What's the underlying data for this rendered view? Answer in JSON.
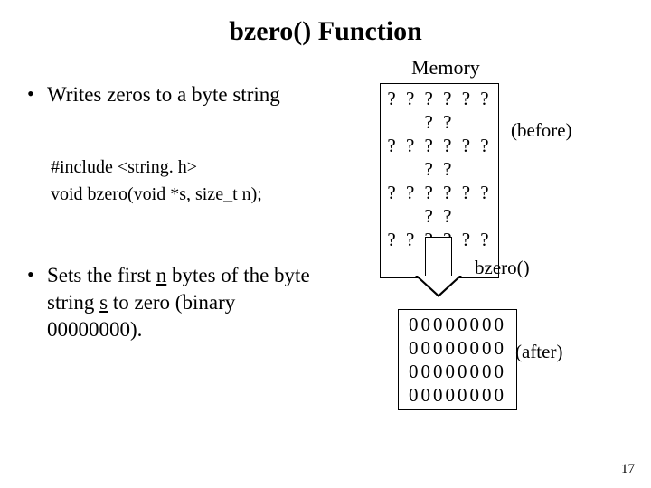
{
  "title": "bzero() Function",
  "bullets": {
    "b1": "Writes zeros to a byte string",
    "code1": "#include <string. h>",
    "code2": "void bzero(void *s, size_t n);",
    "b2_pre": "Sets the first ",
    "b2_n": "n",
    "b2_mid": " bytes of the byte string ",
    "b2_s": "s",
    "b2_post": " to zero (binary 00000000)."
  },
  "memory": {
    "label": "Memory",
    "before_rows": [
      "? ? ? ? ? ? ? ?",
      "? ? ? ? ? ? ? ?",
      "? ? ? ? ? ? ? ?",
      "? ? ? ? ? ? ? ?"
    ],
    "after_rows": [
      "00000000",
      "00000000",
      "00000000",
      "00000000"
    ],
    "before_label": "(before)",
    "after_label": "(after)",
    "call": "bzero()"
  },
  "page_number": "17"
}
